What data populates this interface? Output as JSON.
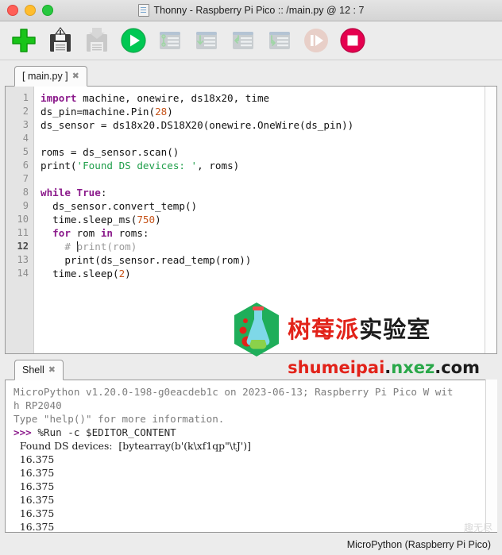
{
  "window": {
    "title": "Thonny  -  Raspberry Pi Pico :: /main.py  @  12 : 7",
    "doc_icon": "document-icon",
    "traffic": {
      "close": "close-window-button",
      "minimize": "minimize-window-button",
      "zoom": "zoom-window-button"
    }
  },
  "toolbar": {
    "buttons": [
      {
        "name": "new-file-button",
        "label": "New",
        "icon": "green-plus-icon",
        "enabled": true
      },
      {
        "name": "save-file-button",
        "label": "Save",
        "icon": "floppy-save-icon",
        "enabled": true
      },
      {
        "name": "load-file-button",
        "label": "Load",
        "icon": "floppy-load-icon",
        "enabled": false
      },
      {
        "name": "run-button",
        "label": "Run",
        "icon": "green-play-icon",
        "enabled": true
      },
      {
        "name": "debug-button",
        "label": "Debug",
        "icon": "debug-icon",
        "enabled": false
      },
      {
        "name": "step-over-button",
        "label": "Step over",
        "icon": "step-over-icon",
        "enabled": false
      },
      {
        "name": "step-into-button",
        "label": "Step into",
        "icon": "step-into-icon",
        "enabled": false
      },
      {
        "name": "step-out-button",
        "label": "Step out",
        "icon": "step-out-icon",
        "enabled": false
      },
      {
        "name": "resume-button",
        "label": "Resume",
        "icon": "resume-icon",
        "enabled": false
      },
      {
        "name": "stop-button",
        "label": "Stop",
        "icon": "red-stop-icon",
        "enabled": true
      }
    ]
  },
  "editor": {
    "tab": {
      "label": "[ main.py ]",
      "close": "✖"
    },
    "current_line": 12,
    "lines": [
      {
        "n": 1,
        "tokens": [
          {
            "t": "import",
            "c": "kw"
          },
          {
            "t": " machine, onewire, ds18x20, time",
            "c": ""
          }
        ]
      },
      {
        "n": 2,
        "tokens": [
          {
            "t": "ds_pin=machine.Pin(",
            "c": ""
          },
          {
            "t": "28",
            "c": "num"
          },
          {
            "t": ")",
            "c": ""
          }
        ]
      },
      {
        "n": 3,
        "tokens": [
          {
            "t": "ds_sensor = ds18x20.DS18X20(onewire.OneWire(ds_pin))",
            "c": ""
          }
        ]
      },
      {
        "n": 4,
        "tokens": [
          {
            "t": "",
            "c": ""
          }
        ]
      },
      {
        "n": 5,
        "tokens": [
          {
            "t": "roms = ds_sensor.scan()",
            "c": ""
          }
        ]
      },
      {
        "n": 6,
        "tokens": [
          {
            "t": "print(",
            "c": ""
          },
          {
            "t": "'Found DS devices: '",
            "c": "str"
          },
          {
            "t": ", roms)",
            "c": ""
          }
        ]
      },
      {
        "n": 7,
        "tokens": [
          {
            "t": "",
            "c": ""
          }
        ]
      },
      {
        "n": 8,
        "tokens": [
          {
            "t": "while",
            "c": "kw"
          },
          {
            "t": " ",
            "c": ""
          },
          {
            "t": "True",
            "c": "kw"
          },
          {
            "t": ":",
            "c": ""
          }
        ]
      },
      {
        "n": 9,
        "tokens": [
          {
            "t": "  ds_sensor.convert_temp()",
            "c": ""
          }
        ]
      },
      {
        "n": 10,
        "tokens": [
          {
            "t": "  time.sleep_ms(",
            "c": ""
          },
          {
            "t": "750",
            "c": "num"
          },
          {
            "t": ")",
            "c": ""
          }
        ]
      },
      {
        "n": 11,
        "tokens": [
          {
            "t": "  ",
            "c": ""
          },
          {
            "t": "for",
            "c": "kw"
          },
          {
            "t": " rom ",
            "c": ""
          },
          {
            "t": "in",
            "c": "kw"
          },
          {
            "t": " roms:",
            "c": ""
          }
        ]
      },
      {
        "n": 12,
        "tokens": [
          {
            "t": "    # ",
            "c": "comment"
          },
          {
            "t": "",
            "c": "caret"
          },
          {
            "t": "print(rom)",
            "c": "comment"
          }
        ]
      },
      {
        "n": 13,
        "tokens": [
          {
            "t": "    print(ds_sensor.read_temp(rom))",
            "c": ""
          }
        ]
      },
      {
        "n": 14,
        "tokens": [
          {
            "t": "  time.sleep(",
            "c": ""
          },
          {
            "t": "2",
            "c": "num"
          },
          {
            "t": ")",
            "c": ""
          }
        ]
      }
    ]
  },
  "watermark": {
    "cn_red": "树莓派",
    "cn_black": "实验室",
    "url_red": "shumeipai",
    "url_dot": ".",
    "url_green": "nxez",
    "url_tld": ".com",
    "logo": "flask-hexagon-logo"
  },
  "shell": {
    "tab": {
      "label": "Shell",
      "close": "✖"
    },
    "lines": [
      {
        "cls": "sh-sys",
        "text": "MicroPython v1.20.0-198-g0eacdeb1c on 2023-06-13; Raspberry Pi Pico W wit"
      },
      {
        "cls": "sh-sys",
        "text": "h RP2040"
      },
      {
        "cls": "sh-sys",
        "text": "Type \"help()\" for more information."
      },
      {
        "cls": "prompt",
        "prompt": ">>> ",
        "text": "%Run -c $EDITOR_CONTENT"
      },
      {
        "cls": "sh-out",
        "text": "  Found DS devices:  [bytearray(b'(k\\xf1qp\"\\tJ')]"
      },
      {
        "cls": "sh-out",
        "text": "  16.375"
      },
      {
        "cls": "sh-out",
        "text": "  16.375"
      },
      {
        "cls": "sh-out",
        "text": "  16.375"
      },
      {
        "cls": "sh-out",
        "text": "  16.375"
      },
      {
        "cls": "sh-out",
        "text": "  16.375"
      },
      {
        "cls": "sh-out",
        "text": "  16.375"
      }
    ]
  },
  "statusbar": {
    "interpreter": "MicroPython (Raspberry Pi Pico)"
  },
  "corner_mark": {
    "text": "趣无尽"
  },
  "colors": {
    "accent_green": "#00c853",
    "stop_red": "#e5004f",
    "keyword": "#8b1a8b",
    "string": "#1f9e4a",
    "number": "#c6541a",
    "comment": "#9a9a9a",
    "brand_red": "#e2231a",
    "brand_green": "#2aa84a"
  }
}
